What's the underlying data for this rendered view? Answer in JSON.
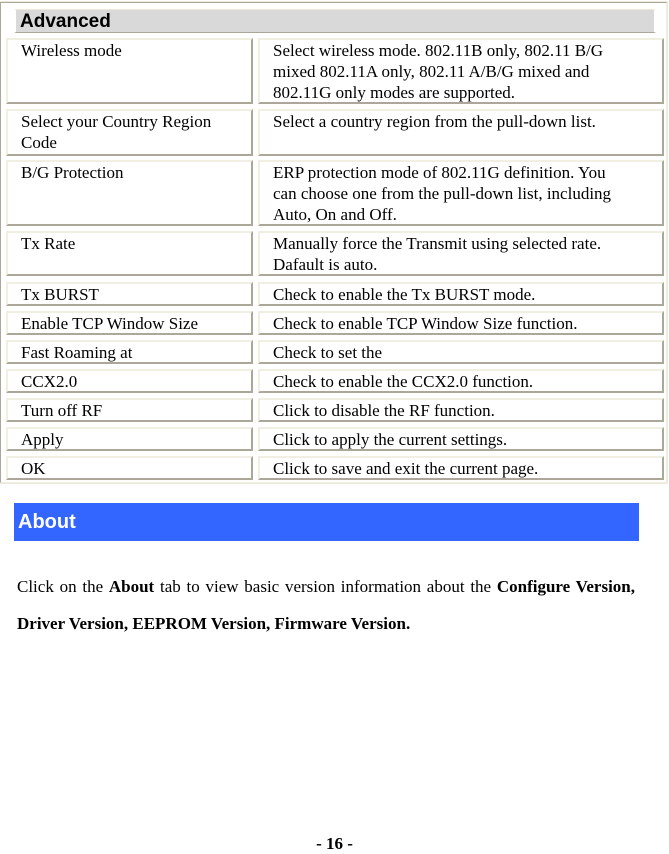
{
  "advanced": {
    "title": "Advanced",
    "rows": [
      {
        "label": "Wireless mode",
        "description": [
          "Select wireless mode. 802.11B only, 802.11 B/G",
          "mixed 802.11A only, 802.11 A/B/G mixed and",
          "802.11G only modes are supported."
        ]
      },
      {
        "label": [
          "Select your Country Region",
          "Code"
        ],
        "description": [
          "Select a country region from the pull-down list."
        ]
      },
      {
        "label": "B/G Protection",
        "description": [
          "ERP protection mode of 802.11G definition. You",
          "can choose one from the pull-down list, including",
          "Auto, On and Off."
        ]
      },
      {
        "label": "Tx Rate",
        "description": [
          "Manually force the Transmit using selected rate.",
          "Dafault is auto."
        ]
      },
      {
        "label": "Tx BURST",
        "description": [
          "Check to enable the Tx BURST mode."
        ]
      },
      {
        "label": "Enable TCP Window Size",
        "description": [
          "Check to enable TCP Window Size function."
        ]
      },
      {
        "label": "Fast Roaming at",
        "description": [
          "Check to set the"
        ]
      },
      {
        "label": "CCX2.0",
        "description": [
          "Check to enable the CCX2.0 function."
        ]
      },
      {
        "label": "Turn off RF",
        "description": [
          "Click to disable the RF function."
        ]
      },
      {
        "label": "Apply",
        "description": [
          "Click to apply the current settings."
        ]
      },
      {
        "label": "OK",
        "description": [
          "Click to save and exit the current page."
        ]
      }
    ]
  },
  "about": {
    "title": "About",
    "bar_color": "#3366ff",
    "paragraph": {
      "t1": "Click on the ",
      "b1": "About",
      "t2": " tab to view basic version information about the ",
      "b2": "Configure Version, Driver Version, EEPROM Version, Firmware Version."
    }
  },
  "footer": {
    "page_number": "- 16 -"
  }
}
